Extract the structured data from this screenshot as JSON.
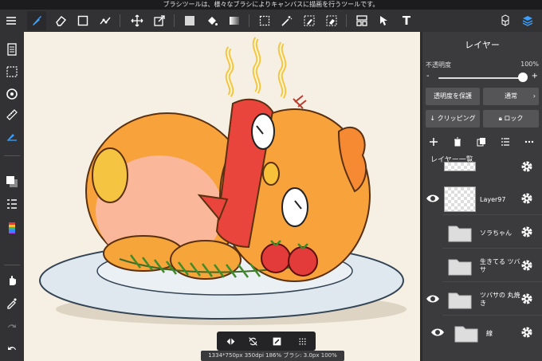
{
  "hint": "ブラシツールは、様々なブラシによりキャンバスに描画を行うツールです。",
  "toolbar": {
    "menu": "menu-icon",
    "brush": "brush-icon",
    "eraser": "eraser-icon",
    "rect": "rectangle-icon",
    "snap": "snap-icon",
    "move": "move-icon",
    "transform": "transform-icon",
    "fill_color": "fill-color-icon",
    "bucket": "bucket-icon",
    "gradient": "gradient-icon",
    "select": "select-rect-icon",
    "wand": "magic-wand-icon",
    "select_pen": "select-pen-icon",
    "select_eraser": "select-eraser-icon",
    "frame": "frame-divider-icon",
    "operation": "operation-icon",
    "text": "T",
    "material": "material-icon",
    "layers": "layers-icon",
    "accent": "#3aa0ff"
  },
  "left": {
    "tools": [
      "pages-icon",
      "selection-icon",
      "rotate-icon",
      "ruler-icon",
      "brush-settings-icon",
      "color-icon",
      "brush-list-icon",
      "palette-icon",
      "hand-icon",
      "eyedropper-icon",
      "redo-icon",
      "undo-icon"
    ]
  },
  "status": "1334*750px 350dpi 186% ブラシ: 3.0px 100%",
  "quick": [
    "flip-icon",
    "rotate-lock-icon",
    "layer-icon",
    "grid-icon"
  ],
  "panel": {
    "title": "レイヤー",
    "opacity_label": "不透明度",
    "opacity_value": "100%",
    "opacity_fraction": 1.0,
    "protect_label": "透明度を保護",
    "blend_label": "通常",
    "clipping_label": "クリッピング",
    "lock_label": "ロック",
    "list_label": "レイヤー一覧",
    "layers": [
      {
        "name": "Layer97",
        "visible": true,
        "type": "layer"
      },
      {
        "name": "ソラちゃん",
        "visible": false,
        "type": "folder"
      },
      {
        "name": "生きてる ツバサ",
        "visible": false,
        "type": "folder"
      },
      {
        "name": "ツバサの 丸焼き",
        "visible": true,
        "type": "folder"
      },
      {
        "name": "線",
        "visible": true,
        "type": "folder"
      }
    ]
  },
  "colors": {
    "canvas": "#f6f0e4",
    "body": "#f7a23a",
    "belly": "#fbb79a",
    "plate": "#dfe8ee",
    "tomato": "#e33a3a"
  }
}
